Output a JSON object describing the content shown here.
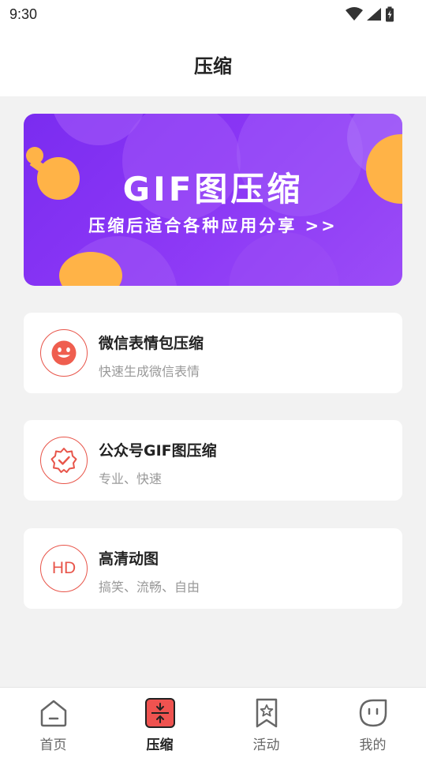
{
  "status": {
    "time": "9:30"
  },
  "header": {
    "title": "压缩"
  },
  "banner": {
    "title": "GIF图压缩",
    "subtitle": "压缩后适合各种应用分享 >>",
    "colors": {
      "background": "#8a36f5",
      "accent": "#ffb347"
    }
  },
  "cards": [
    {
      "icon": "smiley-face-icon",
      "title": "微信表情包压缩",
      "desc": "快速生成微信表情"
    },
    {
      "icon": "badge-check-icon",
      "title": "公众号GIF图压缩",
      "desc": "专业、快速"
    },
    {
      "icon": "hd-icon",
      "icon_text": "HD",
      "title": "高清动图",
      "desc": "搞笑、流畅、自由"
    }
  ],
  "nav": {
    "items": [
      {
        "label": "首页",
        "icon": "home-icon",
        "active": false
      },
      {
        "label": "压缩",
        "icon": "compress-icon",
        "active": true
      },
      {
        "label": "活动",
        "icon": "bookmark-star-icon",
        "active": false
      },
      {
        "label": "我的",
        "icon": "profile-face-icon",
        "active": false
      }
    ]
  },
  "colors": {
    "accent": "#e8554a",
    "page_bg": "#f2f2f2"
  }
}
